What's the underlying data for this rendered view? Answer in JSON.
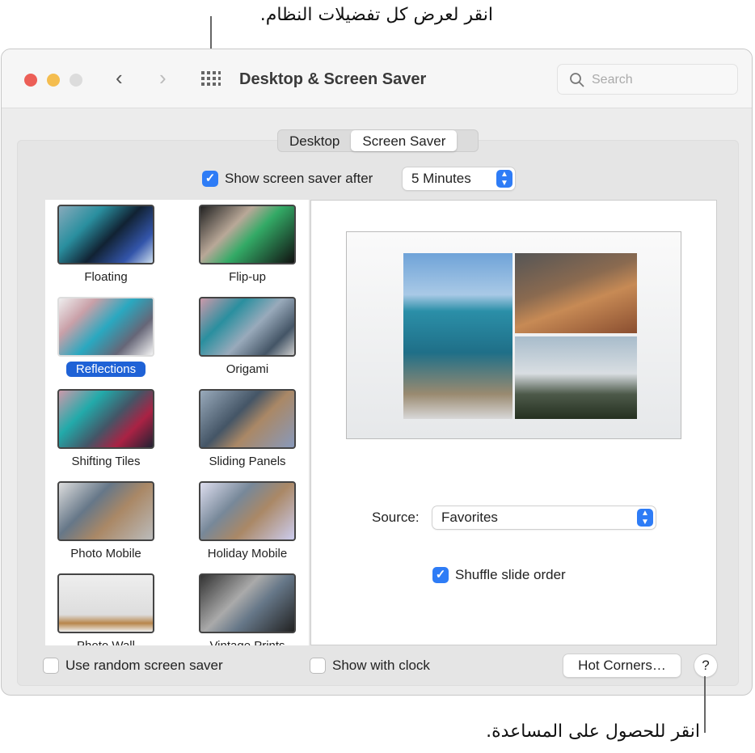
{
  "callouts": {
    "top": "انقر لعرض كل تفضيلات النظام.",
    "bottom": "انقر للحصول على المساعدة."
  },
  "window": {
    "title": "Desktop & Screen Saver",
    "search_placeholder": "Search"
  },
  "tabs": [
    {
      "label": "Desktop",
      "selected": false
    },
    {
      "label": "Screen Saver",
      "selected": true
    }
  ],
  "show_after": {
    "label": "Show screen saver after",
    "checked": true,
    "value": "5 Minutes"
  },
  "savers": [
    {
      "label": "Floating"
    },
    {
      "label": "Flip-up"
    },
    {
      "label": "Reflections",
      "selected": true
    },
    {
      "label": "Origami"
    },
    {
      "label": "Shifting Tiles"
    },
    {
      "label": "Sliding Panels"
    },
    {
      "label": "Photo Mobile"
    },
    {
      "label": "Holiday Mobile"
    },
    {
      "label": "Photo Wall"
    },
    {
      "label": "Vintage Prints"
    }
  ],
  "source": {
    "label": "Source:",
    "value": "Favorites"
  },
  "shuffle": {
    "label": "Shuffle slide order",
    "checked": true
  },
  "bottom": {
    "random_label": "Use random screen saver",
    "random_checked": false,
    "clock_label": "Show with clock",
    "clock_checked": false,
    "hot_corners": "Hot Corners…",
    "help": "?"
  },
  "colors": {
    "accent": "#2e7cf6",
    "selection": "#1f62d6",
    "close": "#ec5f57",
    "minimize": "#f4bd4f",
    "zoom": "#dcdcdc"
  }
}
